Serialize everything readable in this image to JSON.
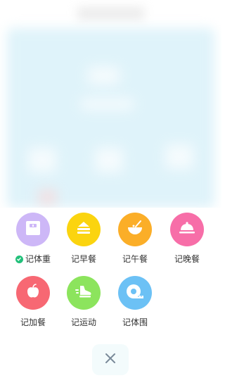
{
  "actions": [
    {
      "label": "记体重",
      "color": "#cdb7f7",
      "icon": "scale-icon",
      "checked": true
    },
    {
      "label": "记早餐",
      "color": "#fbd40f",
      "icon": "sandwich-icon",
      "checked": false
    },
    {
      "label": "记午餐",
      "color": "#fbae28",
      "icon": "bowl-icon",
      "checked": false
    },
    {
      "label": "记晚餐",
      "color": "#f76ea8",
      "icon": "dish-cover-icon",
      "checked": false
    },
    {
      "label": "记加餐",
      "color": "#f76873",
      "icon": "apple-icon",
      "checked": false
    },
    {
      "label": "记运动",
      "color": "#8ce45d",
      "icon": "shoe-icon",
      "checked": false
    },
    {
      "label": "记体围",
      "color": "#6cc1f5",
      "icon": "tape-measure-icon",
      "checked": false
    }
  ],
  "colors": {
    "check": "#22c07a",
    "close_icon": "#7a8a99"
  }
}
